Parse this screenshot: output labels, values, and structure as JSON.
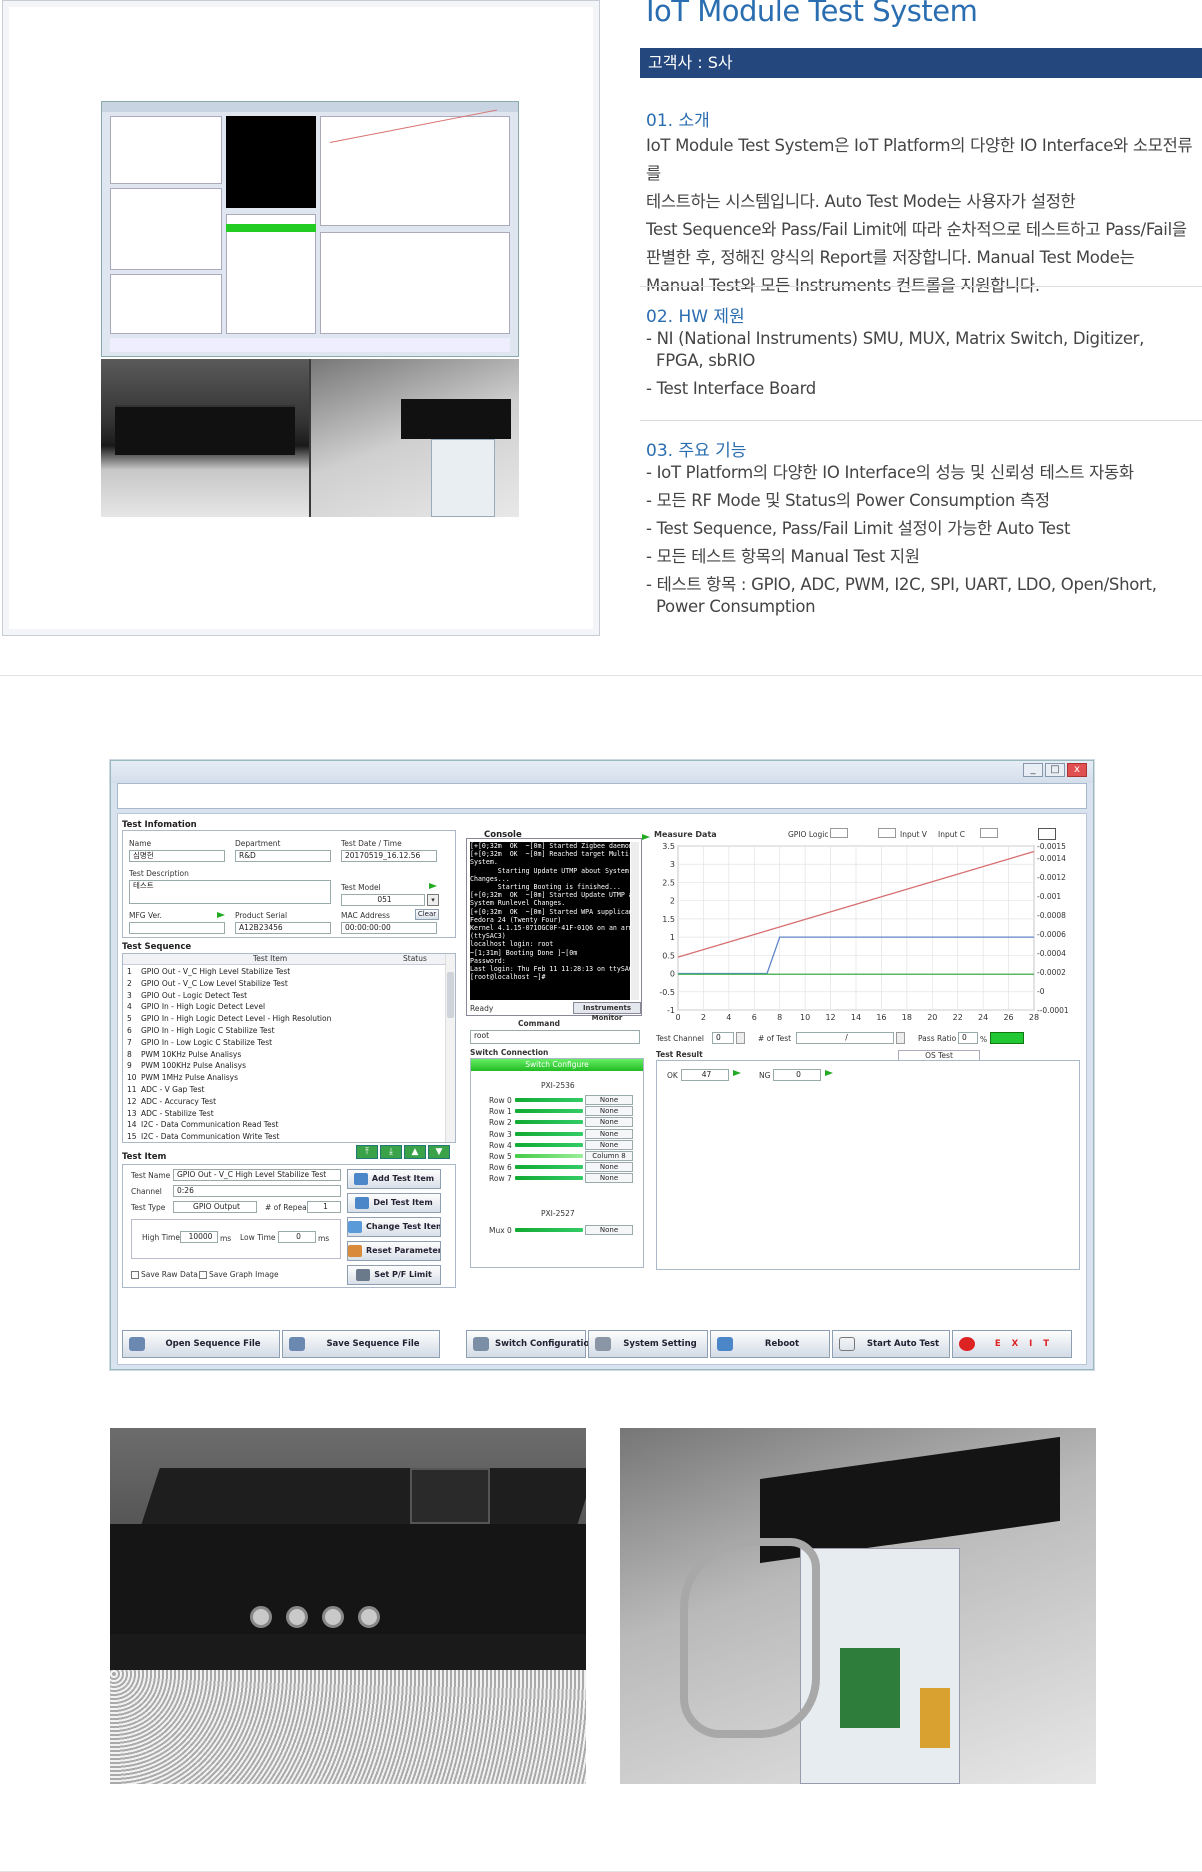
{
  "header": {
    "title": "IoT Module Test System",
    "customer": "고객사 : S사"
  },
  "sections": {
    "intro": {
      "heading": "01. 소개",
      "lines": [
        "IoT Module Test System은 IoT Platform의 다양한 IO Interface와 소모전류를",
        "테스트하는 시스템입니다. Auto Test Mode는 사용자가 설정한",
        "Test Sequence와 Pass/Fail Limit에 따라 순차적으로 테스트하고 Pass/Fail을",
        "판별한 후, 정해진 양식의 Report를 저장합니다. Manual Test Mode는",
        "Manual Test와 모든 Instruments 컨트롤을 지원합니다."
      ]
    },
    "hw": {
      "heading": "02. HW 제원",
      "items": [
        "- NI (National Instruments) SMU, MUX, Matrix Switch, Digitizer, FPGA, sbRIO",
        "- Test Interface Board"
      ]
    },
    "features": {
      "heading": "03. 주요 기능",
      "items": [
        "- IoT Platform의 다양한 IO Interface의 성능 및 신뢰성 테스트 자동화",
        "- 모든 RF Mode 및 Status의 Power Consumption 측정",
        "- Test Sequence, Pass/Fail Limit 설정이 가능한 Auto Test",
        "- 모든 테스트 항목의 Manual Test 지원",
        "- 테스트 항목 : GPIO, ADC, PWM, I2C, SPI, UART, LDO, Open/Short, Power Consumption"
      ]
    }
  },
  "app": {
    "window_buttons": [
      "_",
      "□",
      "x"
    ],
    "test_information": {
      "title": "Test Infomation",
      "name_label": "Name",
      "name_value": "심명헌",
      "department_label": "Department",
      "department_value": "R&D",
      "date_label": "Test Date / Time",
      "date_value": "20170519_16.12.56",
      "description_label": "Test Description",
      "description_value": "테스트",
      "model_label": "Test Model",
      "model_value": "051",
      "mfg_label": "MFG Ver.",
      "mfg_value": "",
      "serial_label": "Product Serial",
      "serial_value": "A12B23456",
      "mac_label": "MAC Address",
      "mac_value": "00:00:00:00",
      "clear_label": "Clear"
    },
    "test_sequence": {
      "title": "Test Sequence",
      "col_item": "Test Item",
      "col_status": "Status",
      "rows": [
        {
          "no": "1",
          "item": "GPIO Out - V_C High Level Stabilize Test"
        },
        {
          "no": "2",
          "item": "GPIO Out - V_C Low Level Stabilize Test"
        },
        {
          "no": "3",
          "item": "GPIO Out - Logic Detect Test"
        },
        {
          "no": "4",
          "item": "GPIO In - High Logic Detect Level"
        },
        {
          "no": "5",
          "item": "GPIO In - High Logic Detect Level - High Resolution"
        },
        {
          "no": "6",
          "item": "GPIO In - High Logic C Stabilize Test"
        },
        {
          "no": "7",
          "item": "GPIO In - Low Logic C Stabilize Test"
        },
        {
          "no": "8",
          "item": "PWM 10KHz Pulse Analisys"
        },
        {
          "no": "9",
          "item": "PWM 100KHz Pulse Analisys"
        },
        {
          "no": "10",
          "item": "PWM 1MHz Pulse Analisys"
        },
        {
          "no": "11",
          "item": "ADC - V Gap Test"
        },
        {
          "no": "12",
          "item": "ADC - Accuracy Test"
        },
        {
          "no": "13",
          "item": "ADC - Stabilize Test"
        },
        {
          "no": "14",
          "item": "I2C - Data Communication Read Test"
        },
        {
          "no": "15",
          "item": "I2C - Data Communication Write Test"
        }
      ]
    },
    "test_item": {
      "title": "Test Item",
      "name_label": "Test Name",
      "name_value": "GPIO Out - V_C High Level Stabilize Test",
      "channel_label": "Channel",
      "channel_value": "0:26",
      "type_label": "Test Type",
      "type_value": "GPIO Output",
      "repeat_label": "# of Repeat",
      "repeat_value": "1",
      "high_label": "High Time",
      "high_value": "10000",
      "low_label": "Low Time",
      "low_value": "0",
      "unit_ms": "ms",
      "raw_label": "Save Raw Data",
      "graph_label": "Save Graph Image",
      "buttons": [
        "Add Test Item",
        "Del Test Item",
        "Change Test Item",
        "Reset Parameter",
        "Set P/F Limit"
      ]
    },
    "console": {
      "title": "Console",
      "lines": [
        "[+[0;32m  OK  ~[0m] Started Zigbee daemon.",
        "[+[0;32m  OK  ~[0m] Reached target Multi-User",
        "System.",
        "       Starting Update UTMP about System Runlevel",
        "Changes...",
        "       Starting Booting is finished...",
        "[+[0;32m  OK  ~[0m] Started Update UTMP about",
        "System Runlevel Changes.",
        "[+[0;32m  OK  ~[0m] Started WPA supplicant.",
        "",
        "Fedora 24 (Twenty Four)",
        "Kernel 4.1.15-071OGC0F-41F-01Q6 on an armv7l",
        "(ttySAC3)",
        "",
        "localhost login: root",
        "",
        "~[1;31m] Booting Done ]~[0m",
        "Password:",
        "Last login: Thu Feb 11 11:28:13 on ttySAC3",
        "[root@localhost ~]#"
      ],
      "ready": "Ready",
      "instruments_tab": "Instruments Monitor",
      "command_label": "Command",
      "command_value": "root"
    },
    "switch": {
      "title": "Switch Connection",
      "configure": "Switch Configure",
      "pxi_a": "PXI-2536",
      "rows": [
        {
          "label": "Row 0",
          "value": "None",
          "fill": 0.72
        },
        {
          "label": "Row 1",
          "value": "None",
          "fill": 0.72
        },
        {
          "label": "Row 2",
          "value": "None",
          "fill": 0.72
        },
        {
          "label": "Row 3",
          "value": "None",
          "fill": 0.72
        },
        {
          "label": "Row 4",
          "value": "None",
          "fill": 0.72
        },
        {
          "label": "Row 5",
          "value": "Column 8",
          "fill": 0.72
        },
        {
          "label": "Row 6",
          "value": "None",
          "fill": 0.72
        },
        {
          "label": "Row 7",
          "value": "None",
          "fill": 0.72
        }
      ],
      "pxi_b": "PXI-2527",
      "mux_label": "Mux 0",
      "mux_value": "None"
    },
    "measure": {
      "title": "Measure Data",
      "legend_gpio": "GPIO Logic",
      "legend_v": "Input V",
      "legend_c": "Input C",
      "test_channel_label": "Test Channel",
      "test_channel_value": "0",
      "num_test_label": "# of Test",
      "num_test_value": "/",
      "pass_ratio_label": "Pass Ratio",
      "pass_ratio_value": "0",
      "percent": "%",
      "result_label": "Test Result",
      "os_test": "OS Test",
      "ok_label": "OK",
      "ok_value": "47",
      "ng_label": "NG",
      "ng_value": "0"
    },
    "bottom_buttons": [
      "Open Sequence File",
      "Save Sequence File",
      "Switch Configuration",
      "System Setting",
      "Reboot",
      "Start Auto Test",
      "E X I T"
    ]
  },
  "chart_data": {
    "type": "line",
    "x": [
      0,
      2,
      4,
      6,
      8,
      10,
      12,
      14,
      16,
      18,
      20,
      22,
      24,
      26,
      28
    ],
    "xlim": [
      0,
      28
    ],
    "ylim": [
      -1,
      3.5
    ],
    "y_ticks": [
      "3.5",
      "3",
      "2.5",
      "2",
      "1.5",
      "1",
      "0.5",
      "0",
      "-0.5",
      "-1"
    ],
    "y2_ticks": [
      "0.0015",
      "0.0014",
      "0.0012",
      "0.001",
      "0.0008",
      "0.0006",
      "0.0004",
      "0.0002",
      "0",
      "-0.0001"
    ],
    "series": [
      {
        "name": "Input V",
        "color": "#d87070",
        "points": [
          [
            0,
            0.45
          ],
          [
            28,
            3.35
          ]
        ]
      },
      {
        "name": "GPIO Logic",
        "color": "#5f86c9",
        "points": [
          [
            0,
            0
          ],
          [
            7,
            0
          ],
          [
            8,
            1
          ],
          [
            28,
            1
          ]
        ]
      },
      {
        "name": "Input C",
        "color": "#3bb34a",
        "points": [
          [
            0,
            -0.02
          ],
          [
            28,
            -0.02
          ]
        ]
      }
    ]
  }
}
